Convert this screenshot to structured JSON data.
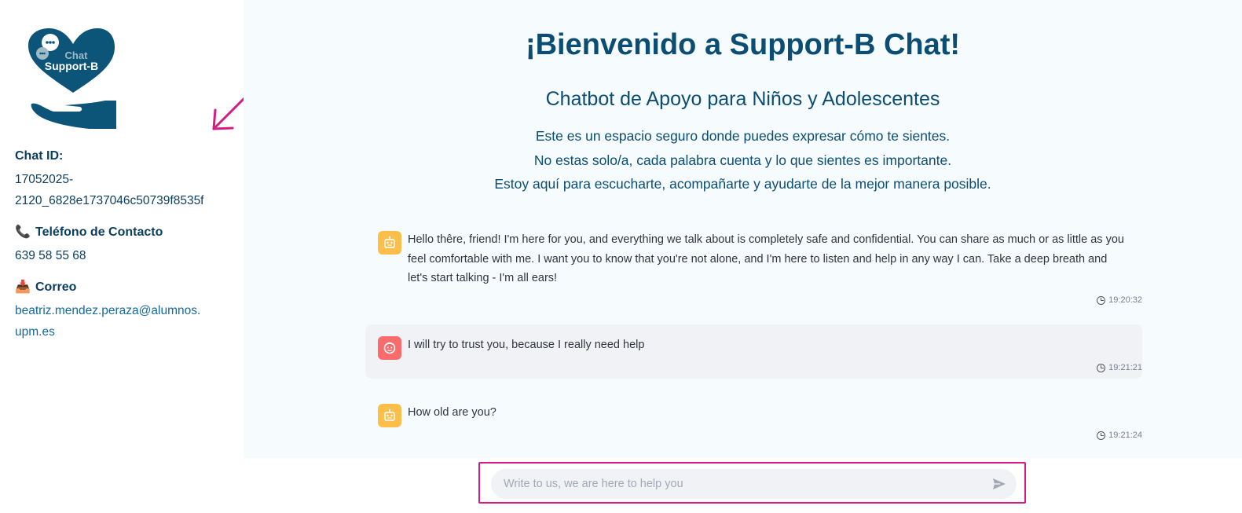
{
  "sidebar": {
    "logo": {
      "line1": "Chat",
      "line2": "Support-B"
    },
    "chat_id": {
      "label": "Chat ID:",
      "value_line1": "17052025-",
      "value_line2": "2120_6828e1737046c50739f8535f"
    },
    "phone": {
      "icon": "phone-emoji",
      "label": "Teléfono de Contacto",
      "value": "639 58 55 68"
    },
    "email": {
      "icon": "inbox-emoji",
      "label": "Correo",
      "value_line1": "beatriz.mendez.peraza@alumnos.",
      "value_line2": "upm.es"
    }
  },
  "main": {
    "title": "¡Bienvenido a Support-B Chat!",
    "subtitle": "Chatbot de Apoyo para Niños y Adolescentes",
    "intro": [
      "Este es un espacio seguro donde puedes expresar cómo te sientes.",
      "No estas solo/a, cada palabra cuenta y lo que sientes es importante.",
      "Estoy aquí para escucharte, acompañarte y ayudarte de la mejor manera posible."
    ]
  },
  "messages": [
    {
      "role": "assistant",
      "text": "Hello thêre, friend! I'm here for you, and everything we talk about is completely safe and confidential. You can share as much or as little as you feel comfortable with me. I want you to know that you're not alone, and I'm here to listen and help in any way I can. Take a deep breath and let's start talking - I'm all ears!",
      "time": "19:20:32"
    },
    {
      "role": "user",
      "text": "I will try to trust you, because I really need help",
      "time": "19:21:21"
    },
    {
      "role": "assistant",
      "text": "How old are you?",
      "time": "19:21:24"
    }
  ],
  "input": {
    "placeholder": "Write to us, we are here to help you",
    "value": ""
  },
  "colors": {
    "brand": "#0b4d73",
    "annotation": "#d61c83",
    "bot_avatar": "#fdbf4a",
    "user_avatar": "#fa6b6b"
  }
}
